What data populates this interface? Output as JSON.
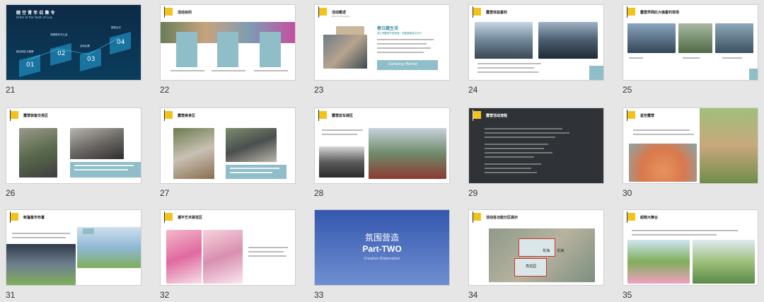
{
  "slides": [
    {
      "num": "21",
      "title": "踏 空 青 年 召 集 令",
      "subtitle": "Order of the Youth of Luis",
      "steps": [
        "01",
        "02",
        "03",
        "04"
      ],
      "step_labels": [
        "踏空网红大赛赛",
        "亮丽新形式公益",
        "活动比赛",
        "颁奖仪式"
      ]
    },
    {
      "num": "22",
      "title": "活动目的",
      "subtitle": "Objective"
    },
    {
      "num": "23",
      "title": "活动概述",
      "subtitle": "Brief introduction",
      "headline": "春日趣生活",
      "line2": "某江湖露营节暨首届一站露营集装文化节",
      "banner": "Camping  Market"
    },
    {
      "num": "24",
      "title": "露营体验垂钓"
    },
    {
      "num": "25",
      "title": "露营界网红大咖垂钓现场"
    },
    {
      "num": "26",
      "title": "露营装备交易区"
    },
    {
      "num": "27",
      "title": "露营美食区"
    },
    {
      "num": "28",
      "title": "露营房车展区"
    },
    {
      "num": "29",
      "title": "露营活动流程"
    },
    {
      "num": "30",
      "title": "星空露营"
    },
    {
      "num": "31",
      "title": "帐篷集市布置"
    },
    {
      "num": "32",
      "title": "潮平艺术展览区"
    },
    {
      "num": "33",
      "title": "氛围营造",
      "part": "Part-TWO",
      "part_sub": "Creative Elaboration"
    },
    {
      "num": "34",
      "title": "活动各功能分区展示",
      "labels": [
        "花海",
        "花海",
        "亮花园"
      ]
    },
    {
      "num": "35",
      "title": "超萌大舞台"
    }
  ],
  "colors": {
    "background": "#e6e6e6",
    "accent": "#f3c21b",
    "teal": "#8fbec9",
    "navy": "#0f2c4d",
    "blue": "#3f63b8"
  }
}
